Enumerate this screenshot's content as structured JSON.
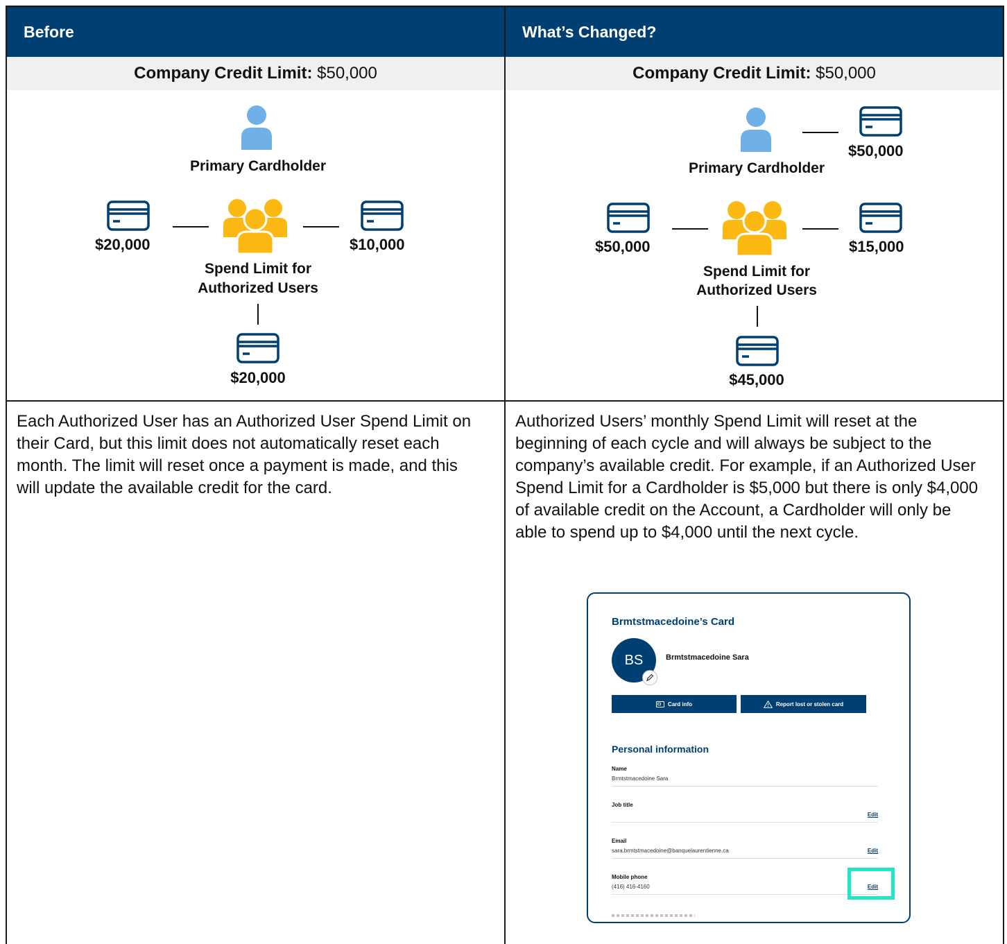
{
  "headers": {
    "before": "Before",
    "changed": "What’s Changed?"
  },
  "credit_limit": {
    "label": "Company Credit Limit:",
    "value": "$50,000"
  },
  "diagram_labels": {
    "primary": "Primary Cardholder",
    "spend_line1": "Spend Limit for",
    "spend_line2": "Authorized Users"
  },
  "before_amounts": {
    "left": "$20,000",
    "right": "$10,000",
    "bottom": "$20,000"
  },
  "changed_amounts": {
    "primary": "$50,000",
    "left": "$50,000",
    "right": "$15,000",
    "bottom": "$45,000"
  },
  "paragraphs": {
    "before": "Each Authorized User has an Authorized User Spend Limit on their Card, but this limit does not automatically reset each month. The limit will reset once a payment is made, and this will update the available credit for the card.",
    "changed": "Authorized Users’ monthly Spend Limit will reset at the beginning of each cycle and will always be subject to the company’s available credit. For example, if an Authorized User Spend Limit for a Cardholder is $5,000 but there is only $4,000 of available credit on the Account, a Cardholder will only be able to spend up to $4,000 until the next cycle."
  },
  "card_screenshot": {
    "title": "Brmtstmacedoine’s Card",
    "avatar_initials": "BS",
    "holder_name": "Brmtstmacedoine Sara",
    "card_info_btn": "Card info",
    "report_btn": "Report lost or stolen card",
    "section_title": "Personal information",
    "edit_label": "Edit",
    "fields": [
      {
        "label": "Name",
        "value": "Brmtstmacedoine Sara"
      },
      {
        "label": "Job title",
        "value": ""
      },
      {
        "label": "Email",
        "value": "sara.brmtstmacedoine@banquelaurentienne.ca"
      },
      {
        "label": "Mobile phone",
        "value": "(416) 416-4160"
      }
    ]
  },
  "colors": {
    "navy": "#003F72",
    "person_blue": "#6FB0E6",
    "group_yellow": "#FDB913",
    "highlight": "#1DE9C6"
  }
}
